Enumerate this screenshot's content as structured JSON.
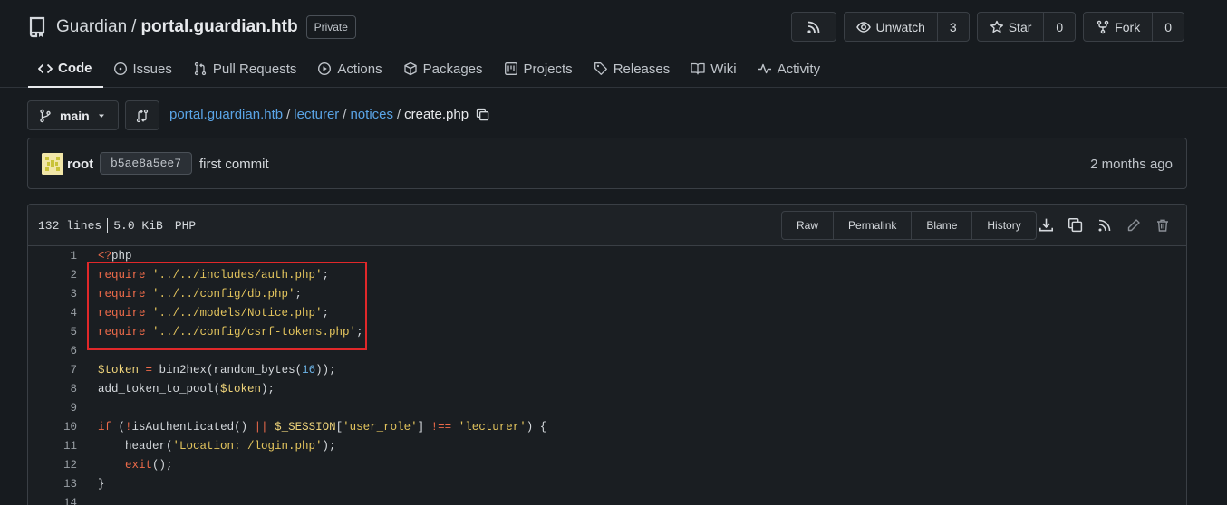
{
  "repo": {
    "owner": "Guardian",
    "separator": "/",
    "name": "portal.guardian.htb",
    "visibility": "Private"
  },
  "header_buttons": {
    "unwatch_label": "Unwatch",
    "watch_count": "3",
    "star_label": "Star",
    "star_count": "0",
    "fork_label": "Fork",
    "fork_count": "0"
  },
  "tabs": [
    {
      "label": "Code",
      "icon": "code-icon",
      "active": true
    },
    {
      "label": "Issues",
      "icon": "issue-icon"
    },
    {
      "label": "Pull Requests",
      "icon": "pull-request-icon"
    },
    {
      "label": "Actions",
      "icon": "play-icon"
    },
    {
      "label": "Packages",
      "icon": "package-icon"
    },
    {
      "label": "Projects",
      "icon": "project-icon"
    },
    {
      "label": "Releases",
      "icon": "tag-icon"
    },
    {
      "label": "Wiki",
      "icon": "book-icon"
    },
    {
      "label": "Activity",
      "icon": "pulse-icon"
    }
  ],
  "branch": {
    "name": "main"
  },
  "breadcrumb": {
    "parts": [
      "portal.guardian.htb",
      "lecturer",
      "notices"
    ],
    "sep": "/",
    "current": "create.php"
  },
  "commit": {
    "user": "root",
    "sha": "b5ae8a5ee7",
    "message": "first commit",
    "time": "2 months ago"
  },
  "file": {
    "lines": "132 lines",
    "size": "5.0 KiB",
    "language": "PHP",
    "buttons": [
      "Raw",
      "Permalink",
      "Blame",
      "History"
    ]
  },
  "code": {
    "line_numbers": [
      "1",
      "2",
      "3",
      "4",
      "5",
      "6",
      "7",
      "8",
      "9",
      "10",
      "11",
      "12",
      "13",
      "14"
    ],
    "lines": [
      [
        {
          "t": "<?",
          "c": "kw"
        },
        {
          "t": "php",
          "c": ""
        }
      ],
      [
        {
          "t": "require ",
          "c": "kw"
        },
        {
          "t": "'../../includes/auth.php'",
          "c": "str"
        },
        {
          "t": ";",
          "c": ""
        }
      ],
      [
        {
          "t": "require ",
          "c": "kw"
        },
        {
          "t": "'../../config/db.php'",
          "c": "str"
        },
        {
          "t": ";",
          "c": ""
        }
      ],
      [
        {
          "t": "require ",
          "c": "kw"
        },
        {
          "t": "'../../models/Notice.php'",
          "c": "str"
        },
        {
          "t": ";",
          "c": ""
        }
      ],
      [
        {
          "t": "require ",
          "c": "kw"
        },
        {
          "t": "'../../config/csrf-tokens.php'",
          "c": "str"
        },
        {
          "t": ";",
          "c": ""
        }
      ],
      [],
      [
        {
          "t": "$token",
          "c": "var"
        },
        {
          "t": " ",
          "c": ""
        },
        {
          "t": "=",
          "c": "kw"
        },
        {
          "t": " bin2hex(random_bytes(",
          "c": ""
        },
        {
          "t": "16",
          "c": "num"
        },
        {
          "t": "));",
          "c": ""
        }
      ],
      [
        {
          "t": "add_token_to_pool(",
          "c": ""
        },
        {
          "t": "$token",
          "c": "var"
        },
        {
          "t": ");",
          "c": ""
        }
      ],
      [],
      [
        {
          "t": "if",
          "c": "kw"
        },
        {
          "t": " (",
          "c": ""
        },
        {
          "t": "!",
          "c": "kw"
        },
        {
          "t": "isAuthenticated() ",
          "c": ""
        },
        {
          "t": "||",
          "c": "kw"
        },
        {
          "t": " ",
          "c": ""
        },
        {
          "t": "$_SESSION",
          "c": "var"
        },
        {
          "t": "[",
          "c": ""
        },
        {
          "t": "'user_role'",
          "c": "str"
        },
        {
          "t": "] ",
          "c": ""
        },
        {
          "t": "!==",
          "c": "kw"
        },
        {
          "t": " ",
          "c": ""
        },
        {
          "t": "'lecturer'",
          "c": "str"
        },
        {
          "t": ") {",
          "c": ""
        }
      ],
      [
        {
          "t": "    header(",
          "c": ""
        },
        {
          "t": "'Location: /login.php'",
          "c": "str"
        },
        {
          "t": ");",
          "c": ""
        }
      ],
      [
        {
          "t": "    ",
          "c": ""
        },
        {
          "t": "exit",
          "c": "kw"
        },
        {
          "t": "();",
          "c": ""
        }
      ],
      [
        {
          "t": "}",
          "c": ""
        }
      ],
      []
    ]
  }
}
